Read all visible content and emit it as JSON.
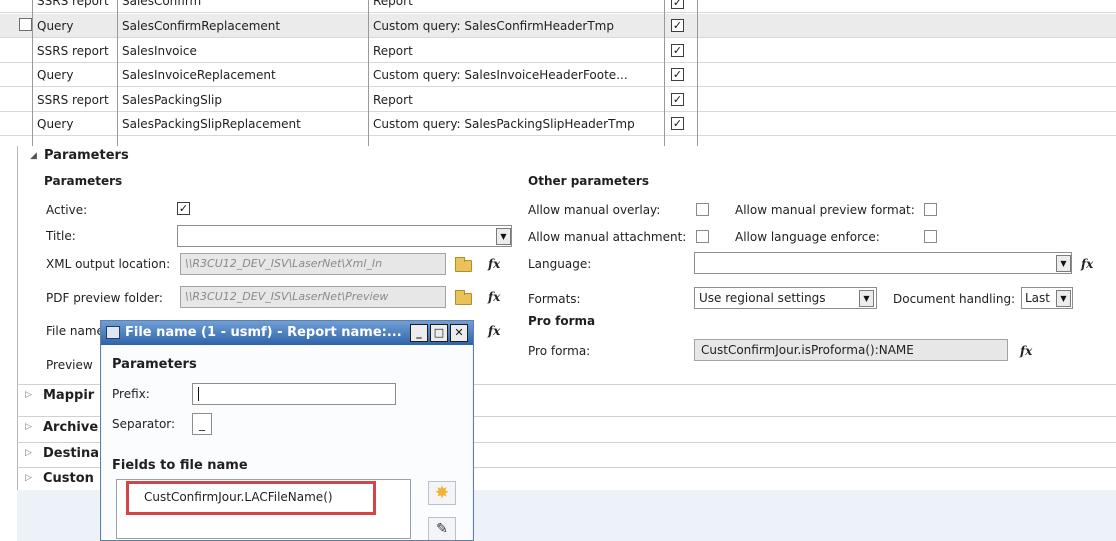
{
  "grid": {
    "rows": [
      {
        "type": "SSRS report",
        "name": "SalesConfirm",
        "description": "Report",
        "checked": true
      },
      {
        "type": "Query",
        "name": "SalesConfirmReplacement",
        "description": "Custom query: SalesConfirmHeaderTmp",
        "checked": true
      },
      {
        "type": "SSRS report",
        "name": "SalesInvoice",
        "description": "Report",
        "checked": true
      },
      {
        "type": "Query",
        "name": "SalesInvoiceReplacement",
        "description": "Custom query: SalesInvoiceHeaderFoote...",
        "checked": true
      },
      {
        "type": "SSRS report",
        "name": "SalesPackingSlip",
        "description": "Report",
        "checked": true
      },
      {
        "type": "Query",
        "name": "SalesPackingSlipReplacement",
        "description": "Custom query: SalesPackingSlipHeaderTmp",
        "checked": true
      }
    ],
    "check_glyph": "✓"
  },
  "params": {
    "section_title": "Parameters",
    "group_title": "Parameters",
    "active_label": "Active:",
    "title_label": "Title:",
    "xml_label": "XML output location:",
    "xml_value": "\\\\R3CU12_DEV_ISV\\LaserNet\\Xml_In",
    "pdf_label": "PDF preview folder:",
    "pdf_value": "\\\\R3CU12_DEV_ISV\\LaserNet\\Preview",
    "file_name_label": "File name",
    "preview_label": "Preview",
    "fx": "fx"
  },
  "other": {
    "group_title": "Other parameters",
    "manual_overlay": "Allow manual overlay:",
    "manual_preview": "Allow manual preview format:",
    "manual_attachment": "Allow manual attachment:",
    "language_enforce": "Allow language enforce:",
    "language": "Language:",
    "formats": "Formats:",
    "formats_value": "Use regional settings",
    "doc_handling": "Document handling:",
    "doc_handling_value": "Last",
    "pro_forma_title": "Pro forma",
    "pro_forma_label": "Pro forma:",
    "pro_forma_value": "CustConfirmJour.isProforma():NAME"
  },
  "collapsed": [
    "Mappir",
    "Archive",
    "Destina",
    "Custon"
  ],
  "dialog": {
    "title": "File name (1 - usmf) - Report name:...",
    "params_title": "Parameters",
    "prefix_label": "Prefix:",
    "separator_label": "Separator:",
    "separator_value": "_",
    "fields_title": "Fields to file name",
    "field_item": "CustConfirmJour.LACFileName()"
  }
}
